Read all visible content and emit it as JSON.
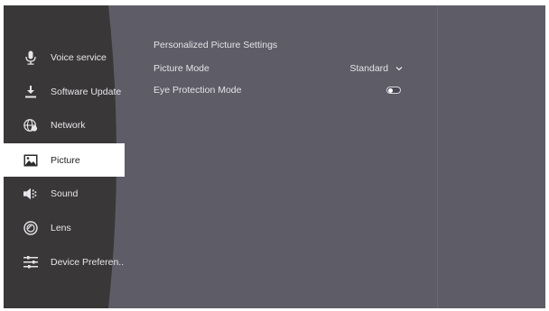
{
  "sidebar": {
    "items": [
      {
        "label": "Voice service",
        "icon": "microphone-icon"
      },
      {
        "label": "Software Update",
        "icon": "download-icon"
      },
      {
        "label": "Network",
        "icon": "globe-network-icon"
      },
      {
        "label": "Picture",
        "icon": "picture-icon",
        "active": true
      },
      {
        "label": "Sound",
        "icon": "speaker-icon"
      },
      {
        "label": "Lens",
        "icon": "lens-icon"
      },
      {
        "label": "Device Preferen..",
        "icon": "sliders-icon"
      }
    ]
  },
  "content": {
    "section_title": "Personalized Picture Settings",
    "picture_mode": {
      "label": "Picture Mode",
      "value": "Standard"
    },
    "eye_protection": {
      "label": "Eye Protection Mode",
      "enabled": false
    }
  },
  "colors": {
    "panel": "#5e5c66",
    "sidebar": "#3a3738",
    "active_item": "#ffffff"
  }
}
